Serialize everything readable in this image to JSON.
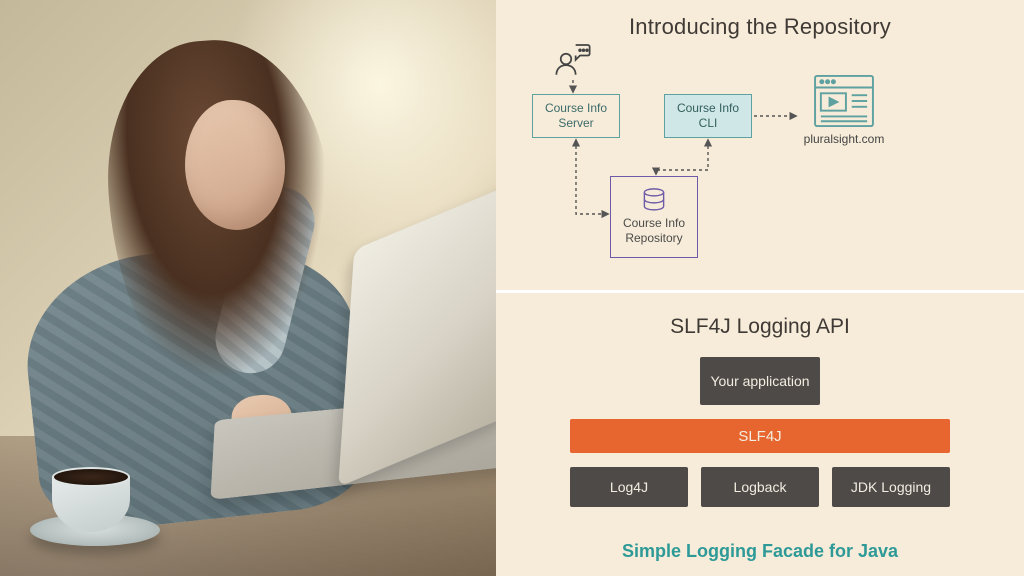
{
  "left_image": {
    "description": "Photograph of a woman with long brown hair in a chunky light-blue cable-knit sweater, seated at a desk typing on a silver laptop; a cup of coffee on a saucer sits in the foreground."
  },
  "top_panel": {
    "title": "Introducing the Repository",
    "user_icon": "user-speech-icon",
    "boxes": {
      "server": "Course Info Server",
      "cli": "Course Info CLI",
      "repo": "Course Info Repository"
    },
    "external": {
      "label": "pluralsight.com",
      "icon": "webpage-video-icon"
    },
    "arrows": [
      {
        "from": "user-icon",
        "to": "server",
        "style": "dotted"
      },
      {
        "from": "cli",
        "to": "external",
        "style": "dotted"
      },
      {
        "from": "server",
        "to": "repo",
        "style": "dotted-bidirectional"
      },
      {
        "from": "cli",
        "to": "repo",
        "style": "dotted-bidirectional"
      }
    ]
  },
  "bottom_panel": {
    "title": "SLF4J Logging API",
    "stack": {
      "app": "Your application",
      "facade": "SLF4J",
      "impls": [
        "Log4J",
        "Logback",
        "JDK Logging"
      ]
    },
    "footer": "Simple Logging Facade for Java"
  },
  "colors": {
    "panel_bg": "#f7ecd9",
    "teal": "#5ea1a0",
    "purple": "#6e5aa8",
    "orange": "#e7662f",
    "dark_tile": "#4d4a47",
    "link_teal": "#2e9a98"
  }
}
